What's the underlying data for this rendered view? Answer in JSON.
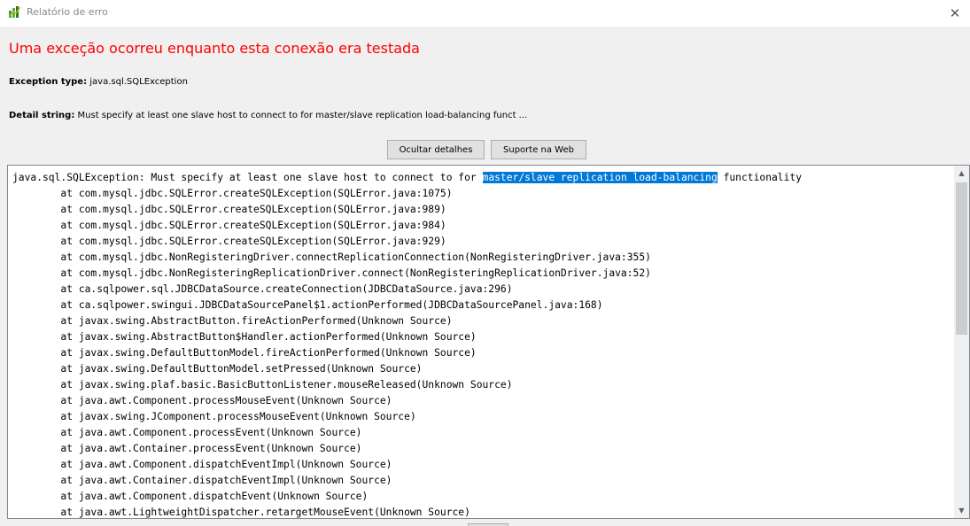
{
  "window": {
    "title": "Relatório de erro",
    "close_glyph": "✕",
    "app_icon": "sql-power-icon"
  },
  "heading": "Uma exceção ocorreu enquanto esta conexão era testada",
  "exception": {
    "type_label": "Exception type:",
    "type_value": "java.sql.SQLException"
  },
  "detail": {
    "label": "Detail string:",
    "value": "Must specify at least one slave host to connect to for master/slave replication load-balancing funct ..."
  },
  "buttons": {
    "hide_details": "Ocultar detalhes",
    "web_support": "Suporte na Web"
  },
  "stack_trace": {
    "first_line_before": "java.sql.SQLException: Must specify at least one slave host to connect to for ",
    "first_line_selected": "master/slave replication load-balancing",
    "first_line_after": " functionality",
    "frames": [
      "        at com.mysql.jdbc.SQLError.createSQLException(SQLError.java:1075)",
      "        at com.mysql.jdbc.SQLError.createSQLException(SQLError.java:989)",
      "        at com.mysql.jdbc.SQLError.createSQLException(SQLError.java:984)",
      "        at com.mysql.jdbc.SQLError.createSQLException(SQLError.java:929)",
      "        at com.mysql.jdbc.NonRegisteringDriver.connectReplicationConnection(NonRegisteringDriver.java:355)",
      "        at com.mysql.jdbc.NonRegisteringReplicationDriver.connect(NonRegisteringReplicationDriver.java:52)",
      "        at ca.sqlpower.sql.JDBCDataSource.createConnection(JDBCDataSource.java:296)",
      "        at ca.sqlpower.swingui.JDBCDataSourcePanel$1.actionPerformed(JDBCDataSourcePanel.java:168)",
      "        at javax.swing.AbstractButton.fireActionPerformed(Unknown Source)",
      "        at javax.swing.AbstractButton$Handler.actionPerformed(Unknown Source)",
      "        at javax.swing.DefaultButtonModel.fireActionPerformed(Unknown Source)",
      "        at javax.swing.DefaultButtonModel.setPressed(Unknown Source)",
      "        at javax.swing.plaf.basic.BasicButtonListener.mouseReleased(Unknown Source)",
      "        at java.awt.Component.processMouseEvent(Unknown Source)",
      "        at javax.swing.JComponent.processMouseEvent(Unknown Source)",
      "        at java.awt.Component.processEvent(Unknown Source)",
      "        at java.awt.Container.processEvent(Unknown Source)",
      "        at java.awt.Component.dispatchEventImpl(Unknown Source)",
      "        at java.awt.Container.dispatchEventImpl(Unknown Source)",
      "        at java.awt.Component.dispatchEvent(Unknown Source)",
      "        at java.awt.LightweightDispatcher.retargetMouseEvent(Unknown Source)"
    ]
  },
  "colors": {
    "heading": "#ff0000",
    "selection": "#0078d7"
  }
}
